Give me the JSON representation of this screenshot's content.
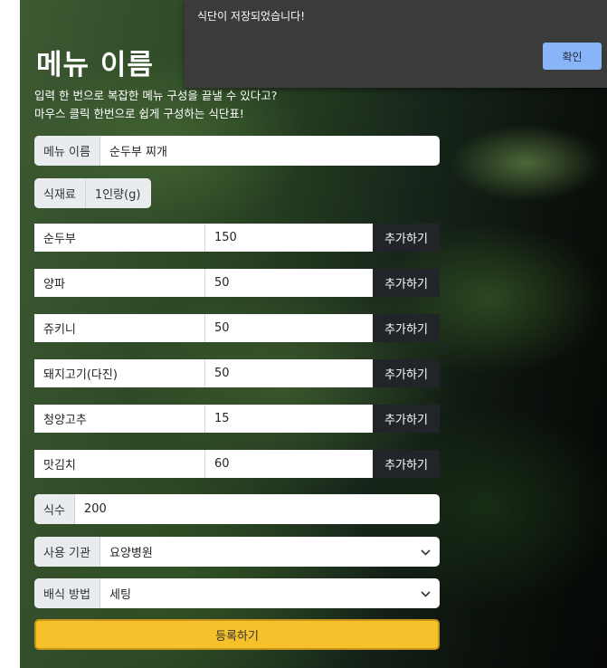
{
  "page": {
    "title": "메뉴 이름",
    "subtitle_line1": "입력 한 번으로 복잡한 메뉴 구성을 끝낼 수 있다고?",
    "subtitle_line2": "마우스 클릭 한번으로 쉽게 구성하는 식단표!"
  },
  "menu_name": {
    "label": "메뉴 이름",
    "value": "순두부 찌개"
  },
  "ingredients_header": {
    "label": "식재료",
    "unit_label": "1인량(g)"
  },
  "ingredients": [
    {
      "name": "순두부",
      "amount": "150",
      "button": "추가하기"
    },
    {
      "name": "양파",
      "amount": "50",
      "button": "추가하기"
    },
    {
      "name": "쥬키니",
      "amount": "50",
      "button": "추가하기"
    },
    {
      "name": "돼지고기(다진)",
      "amount": "50",
      "button": "추가하기"
    },
    {
      "name": "청양고추",
      "amount": "15",
      "button": "추가하기"
    },
    {
      "name": "맛김치",
      "amount": "60",
      "button": "추가하기"
    }
  ],
  "servings": {
    "label": "식수",
    "value": "200"
  },
  "institution": {
    "label": "사용 기관",
    "value": "요양병원"
  },
  "serving_method": {
    "label": "배식 방법",
    "value": "세팅"
  },
  "submit_label": "등록하기",
  "dialog": {
    "message": "식단이 저장되었습니다!",
    "ok_label": "확인"
  }
}
